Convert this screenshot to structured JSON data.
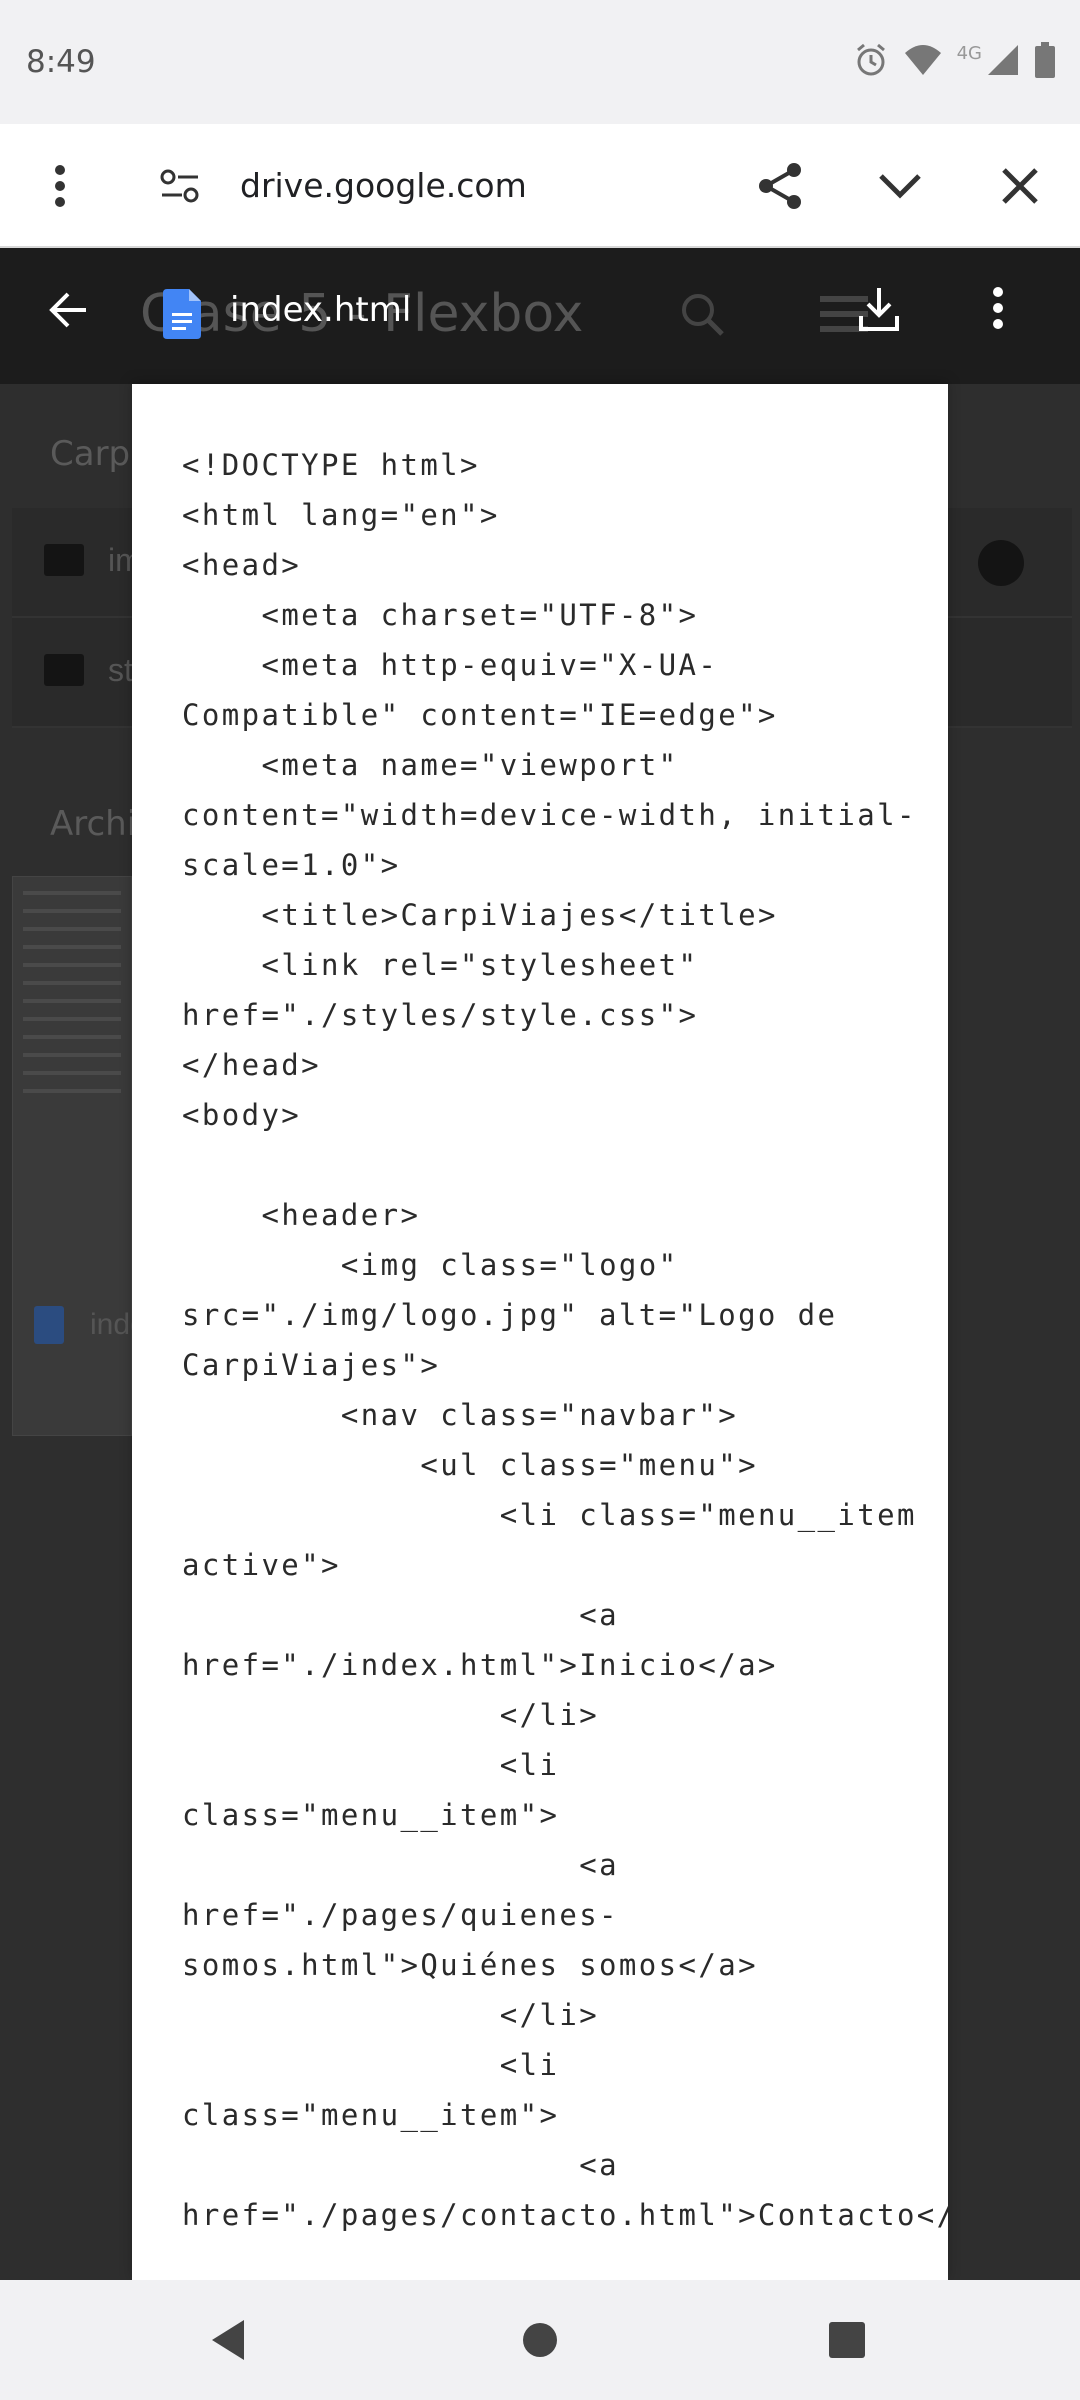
{
  "status_bar": {
    "time": "8:49",
    "network_label": "4G",
    "icons": [
      "alarm-icon",
      "wifi-icon",
      "signal-icon",
      "battery-icon"
    ]
  },
  "toolbar": {
    "url": "drive.google.com",
    "icons": [
      "menu-dots-icon",
      "site-settings-icon",
      "share-icon",
      "chevron-down-icon",
      "close-icon"
    ]
  },
  "drive_background": {
    "folder_title": "Clase 5 - Flexbox",
    "section_folders": "Carpetas",
    "folder_items": [
      "img",
      "styles"
    ],
    "section_files": "Archivos",
    "file_item": "index.html"
  },
  "viewer": {
    "file_name": "index.html",
    "icons": [
      "back-arrow-icon",
      "google-docs-icon",
      "download-icon",
      "more-vert-icon"
    ]
  },
  "document": {
    "content": "<!DOCTYPE html>\n<html lang=\"en\">\n<head>\n    <meta charset=\"UTF-8\">\n    <meta http-equiv=\"X-UA-Compatible\" content=\"IE=edge\">\n    <meta name=\"viewport\" content=\"width=device-width, initial-scale=1.0\">\n    <title>CarpiViajes</title>\n    <link rel=\"stylesheet\" href=\"./styles/style.css\">\n</head>\n<body>\n\n    <header>\n        <img class=\"logo\" src=\"./img/logo.jpg\" alt=\"Logo de CarpiViajes\">\n        <nav class=\"navbar\">\n            <ul class=\"menu\">\n                <li class=\"menu__item active\">\n                    <a href=\"./index.html\">Inicio</a>\n                </li>\n                <li class=\"menu__item\">\n                    <a href=\"./pages/quienes-somos.html\">Quiénes somos</a>\n                </li>\n                <li class=\"menu__item\">\n                    <a href=\"./pages/contacto.html\">Contacto</a>"
  },
  "nav_bar": {
    "icons": [
      "back-triangle-icon",
      "home-circle-icon",
      "recents-square-icon"
    ]
  },
  "colors": {
    "toolbar_bg": "#ffffff",
    "status_bg": "#f1f1f3",
    "dim_bg": "#2e2e2e",
    "doc_icon_blue": "#4285f4"
  }
}
